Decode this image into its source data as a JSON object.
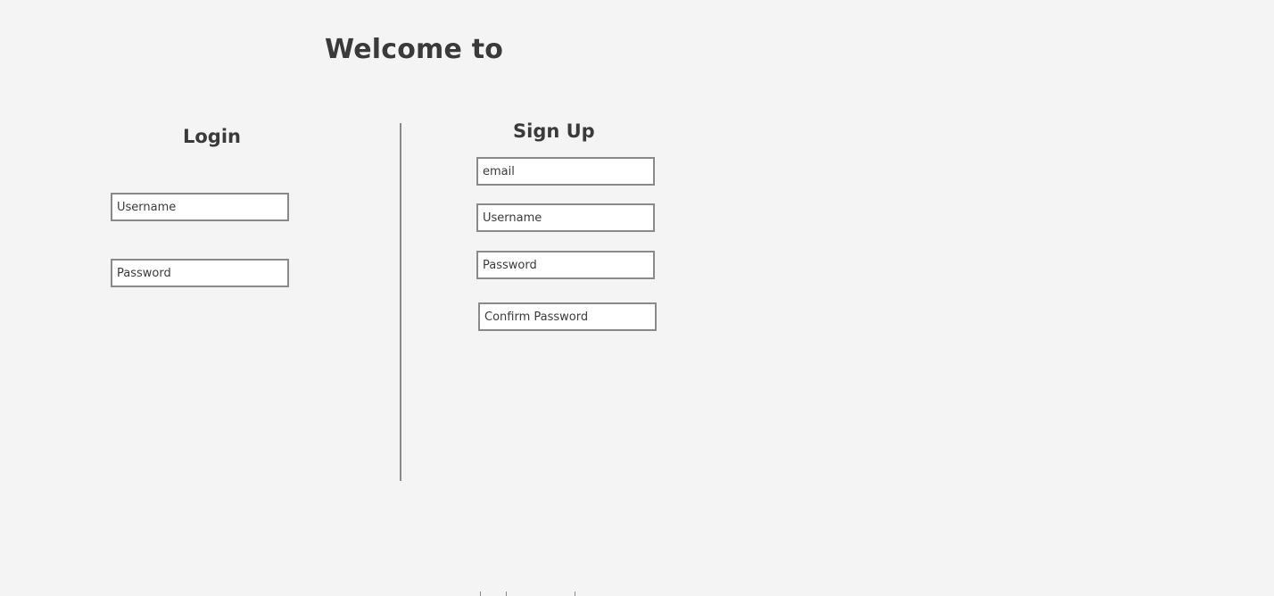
{
  "header": {
    "title": "Welcome to"
  },
  "login": {
    "heading": "Login",
    "username_placeholder": "Username",
    "password_placeholder": "Password"
  },
  "signup": {
    "heading": "Sign Up",
    "email_placeholder": "email",
    "username_placeholder": "Username",
    "password_placeholder": "Password",
    "confirm_password_placeholder": "Confirm Password"
  }
}
